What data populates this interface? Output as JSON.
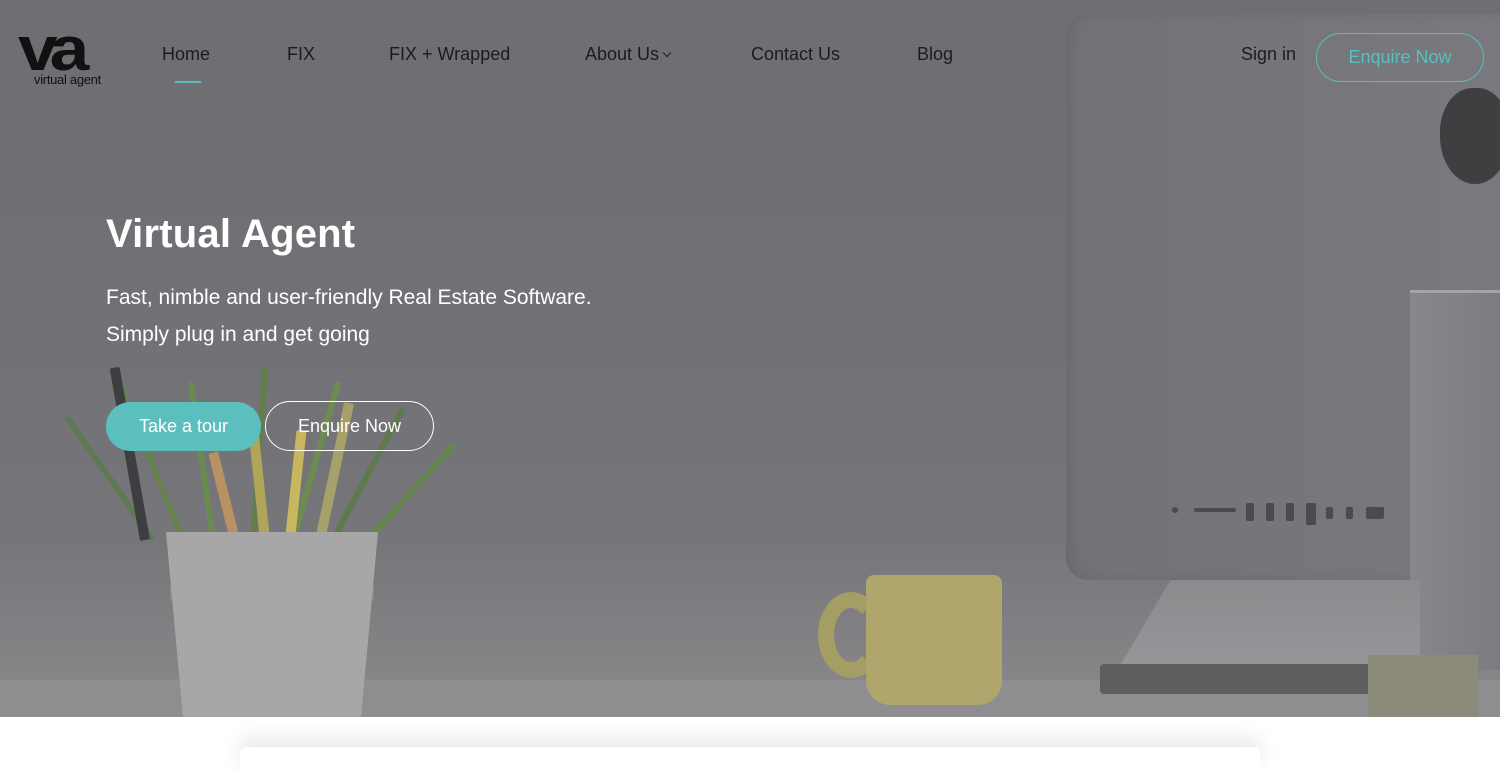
{
  "brand": {
    "logo_mark": "va",
    "logo_text": "virtual agent"
  },
  "nav": {
    "items": [
      {
        "label": "Home",
        "active": true
      },
      {
        "label": "FIX"
      },
      {
        "label": "FIX + Wrapped"
      },
      {
        "label": "About Us",
        "has_dropdown": true
      },
      {
        "label": "Contact Us"
      },
      {
        "label": "Blog"
      }
    ],
    "sign_in": "Sign in",
    "enquire": "Enquire Now"
  },
  "hero": {
    "title": "Virtual Agent",
    "subtitle_line1": "Fast, nimble and user-friendly Real Estate Software.",
    "subtitle_line2": "Simply plug in and get going",
    "primary_button": "Take a tour",
    "secondary_button": "Enquire Now"
  },
  "colors": {
    "accent": "#5bbfbd",
    "nav_text": "#1c1c1e",
    "hero_text": "#ffffff"
  },
  "icons": {
    "dropdown": "chevron-down-icon"
  }
}
